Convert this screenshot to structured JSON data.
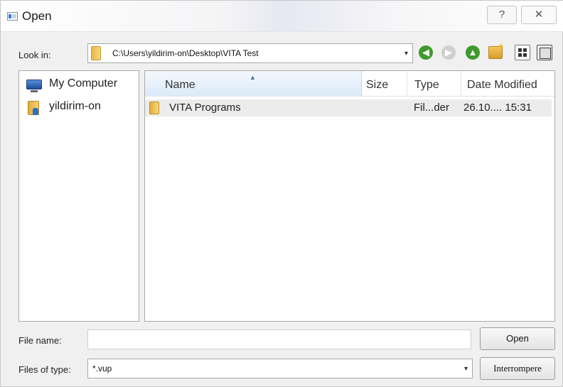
{
  "window": {
    "title": "Open",
    "help_glyph": "?",
    "close_glyph": "✕"
  },
  "toolbar": {
    "look_in_label": "Look in:",
    "path": "C:\\Users\\yildirim-on\\Desktop\\VITA Test",
    "dropdown_arrow": "▾",
    "back_glyph": "◀",
    "forward_glyph": "▶",
    "up_glyph": "▲"
  },
  "sidebar": {
    "items": [
      {
        "label": "My Computer",
        "icon": "computer-icon"
      },
      {
        "label": "yildirim-on",
        "icon": "user-folder-icon"
      }
    ]
  },
  "filelist": {
    "columns": [
      "Name",
      "Size",
      "Type",
      "Date Modified"
    ],
    "sort_glyph": "▲",
    "rows": [
      {
        "name": "VITA Programs",
        "size": "",
        "type": "Fil...der",
        "date": "26.10.... 15:31",
        "icon": "folder-icon"
      }
    ]
  },
  "file_name": {
    "label": "File name:",
    "value": ""
  },
  "file_type": {
    "label": "Files of type:",
    "value": "*.vup",
    "arrow": "▾"
  },
  "buttons": {
    "open": "Open",
    "cancel": "Interrompere"
  }
}
